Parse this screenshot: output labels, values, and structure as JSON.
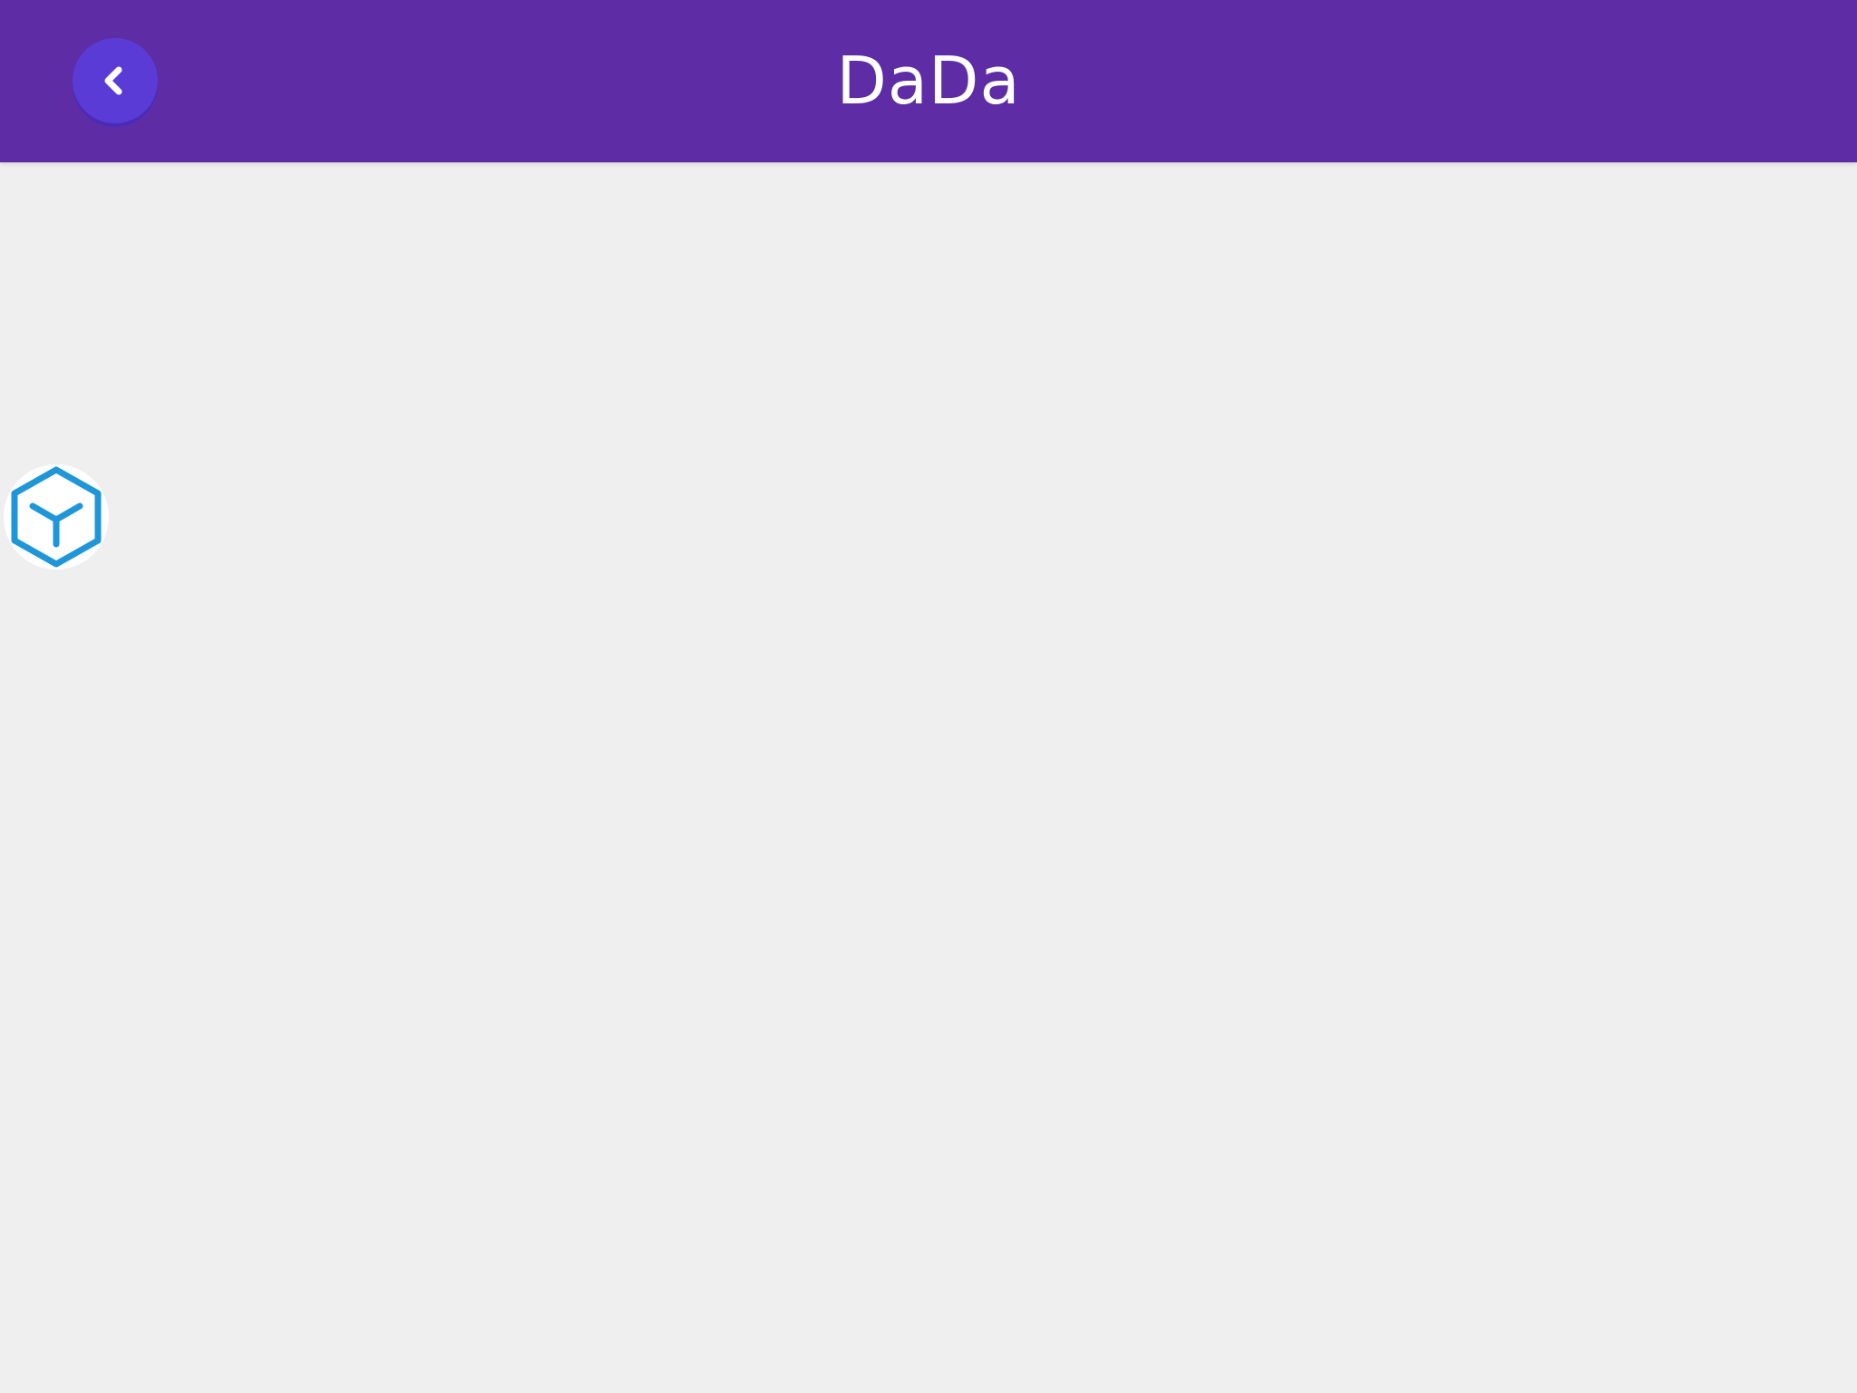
{
  "header": {
    "title": "DaDa",
    "back_icon": "chevron-left-icon",
    "background_color": "#5e2ca5",
    "back_button_color": "#5b3bd6"
  },
  "side_widget": {
    "icon": "cube-icon",
    "icon_color": "#1e96d8"
  },
  "page": {
    "background_color": "#efefef"
  }
}
